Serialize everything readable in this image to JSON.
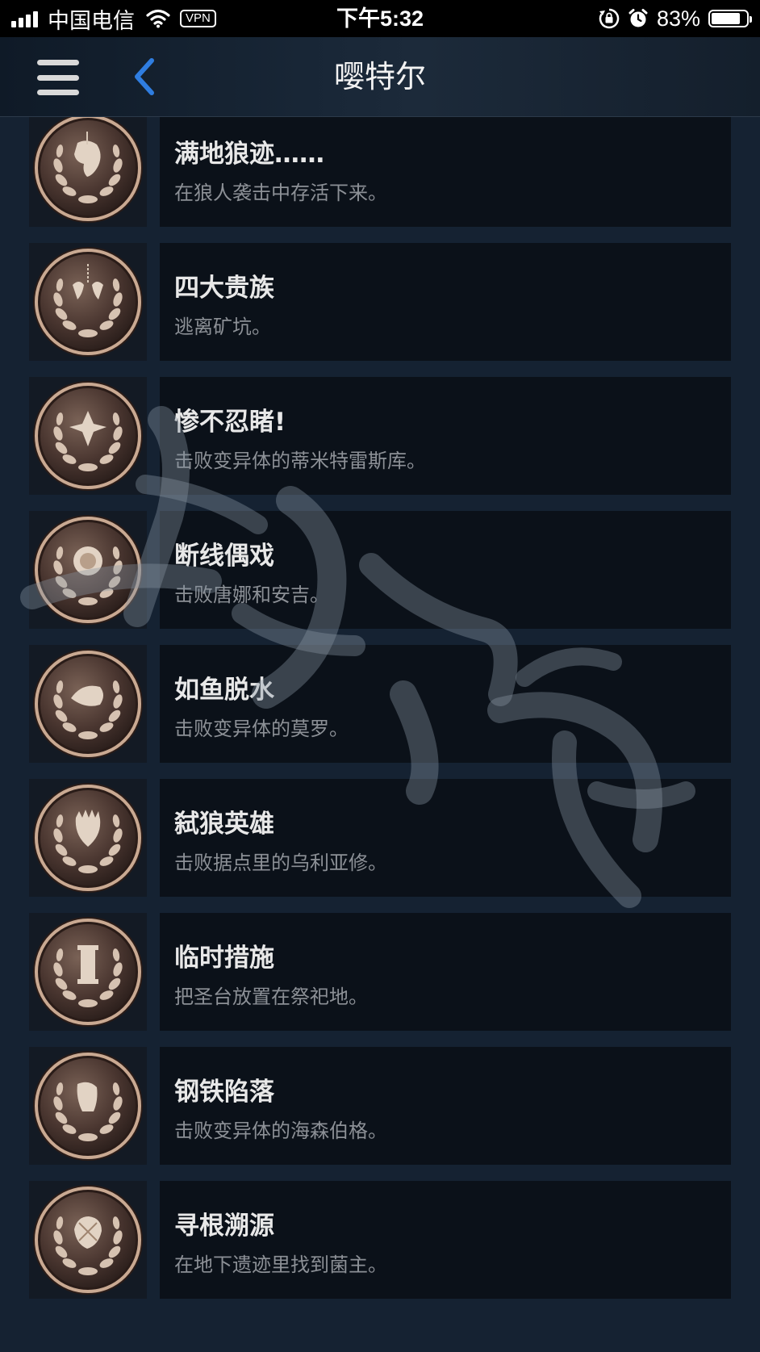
{
  "status_bar": {
    "carrier": "中国电信",
    "vpn": "VPN",
    "time": "下午5:32",
    "battery_percent": "83%",
    "battery_level": 0.83,
    "icons": [
      "signal-icon",
      "wifi-icon",
      "vpn-badge",
      "rotation-lock-icon",
      "alarm-icon",
      "battery-icon"
    ]
  },
  "nav": {
    "title": "嘤特尔",
    "icons": [
      "menu-icon",
      "back-chevron-icon"
    ]
  },
  "achievements": [
    {
      "title": "满地狼迹……",
      "desc": "在狼人袭击中存活下来。",
      "icon": "wolf-head-medal-icon"
    },
    {
      "title": "四大贵族",
      "desc": "逃离矿坑。",
      "icon": "hands-chain-medal-icon"
    },
    {
      "title": "惨不忍睹!",
      "desc": "击败变异体的蒂米特雷斯库。",
      "icon": "cross-medal-icon"
    },
    {
      "title": "断线偶戏",
      "desc": "击败唐娜和安吉。",
      "icon": "sun-face-medal-icon"
    },
    {
      "title": "如鱼脱水",
      "desc": "击败变异体的莫罗。",
      "icon": "fish-medal-icon"
    },
    {
      "title": "弑狼英雄",
      "desc": "击败据点里的乌利亚修。",
      "icon": "crowned-skull-medal-icon"
    },
    {
      "title": "临时措施",
      "desc": "把圣台放置在祭祀地。",
      "icon": "pedestal-medal-icon"
    },
    {
      "title": "钢铁陷落",
      "desc": "击败变异体的海森伯格。",
      "icon": "hammer-medal-icon"
    },
    {
      "title": "寻根溯源",
      "desc": "在地下遗迹里找到菌主。",
      "icon": "fungus-medal-icon"
    }
  ],
  "colors": {
    "background": "#152232",
    "card": "#0b1119",
    "title_text": "#e8e8e8",
    "desc_text": "#8c9096",
    "back_accent": "#2f7de0"
  }
}
